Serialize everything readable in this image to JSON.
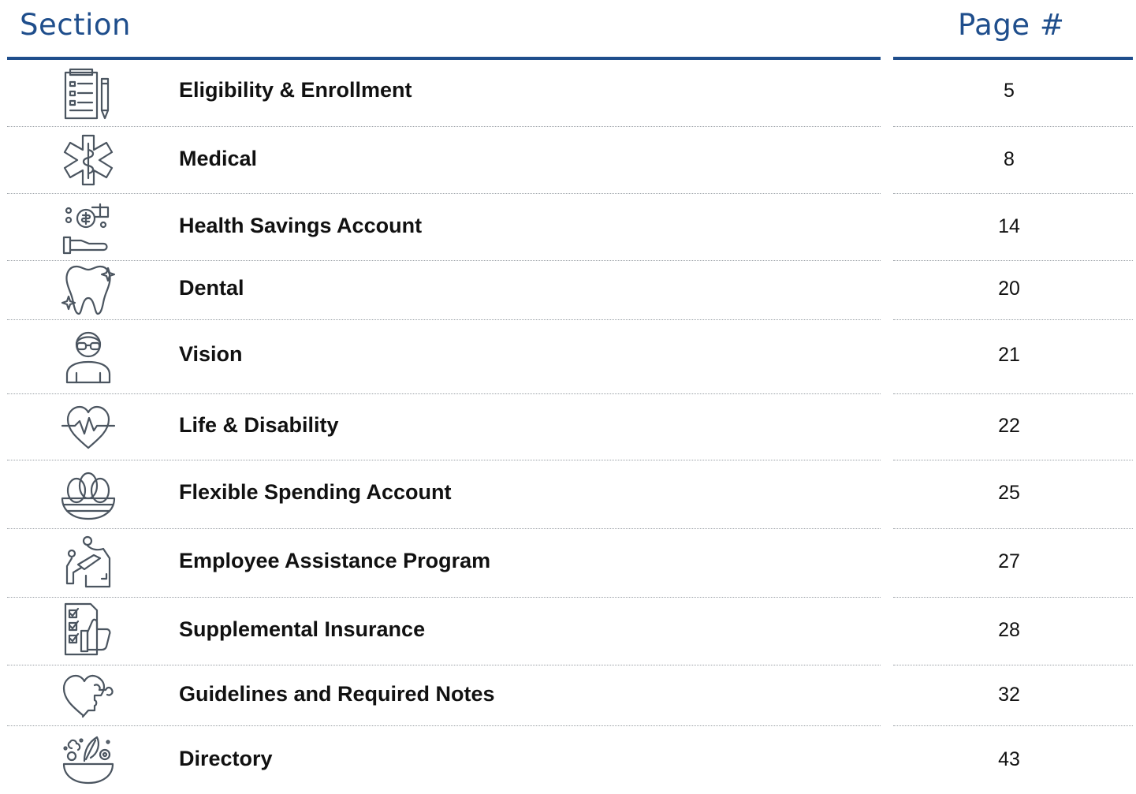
{
  "header": {
    "section_label": "Section",
    "page_label": "Page #"
  },
  "colors": {
    "accent": "#1f4e8c",
    "icon": "#4b5560",
    "divider": "#9aa0a6"
  },
  "rows": [
    {
      "label": "Eligibility & Enrollment",
      "page": "5",
      "icon": "clipboard-pen-icon"
    },
    {
      "label": "Medical",
      "page": "8",
      "icon": "star-of-life-icon"
    },
    {
      "label": "Health Savings Account",
      "page": "14",
      "icon": "hand-money-icon"
    },
    {
      "label": "Dental",
      "page": "20",
      "icon": "tooth-icon"
    },
    {
      "label": "Vision",
      "page": "21",
      "icon": "person-glasses-icon"
    },
    {
      "label": "Life & Disability",
      "page": "22",
      "icon": "heart-pulse-icon"
    },
    {
      "label": "Flexible Spending Account",
      "page": "25",
      "icon": "eggs-basket-icon"
    },
    {
      "label": "Employee Assistance Program",
      "page": "27",
      "icon": "helping-hand-icon"
    },
    {
      "label": "Supplemental Insurance",
      "page": "28",
      "icon": "checklist-thumbs-up-icon"
    },
    {
      "label": "Guidelines and Required Notes",
      "page": "32",
      "icon": "heart-puzzle-icon"
    },
    {
      "label": "Directory",
      "page": "43",
      "icon": "salad-bowl-icon"
    }
  ]
}
